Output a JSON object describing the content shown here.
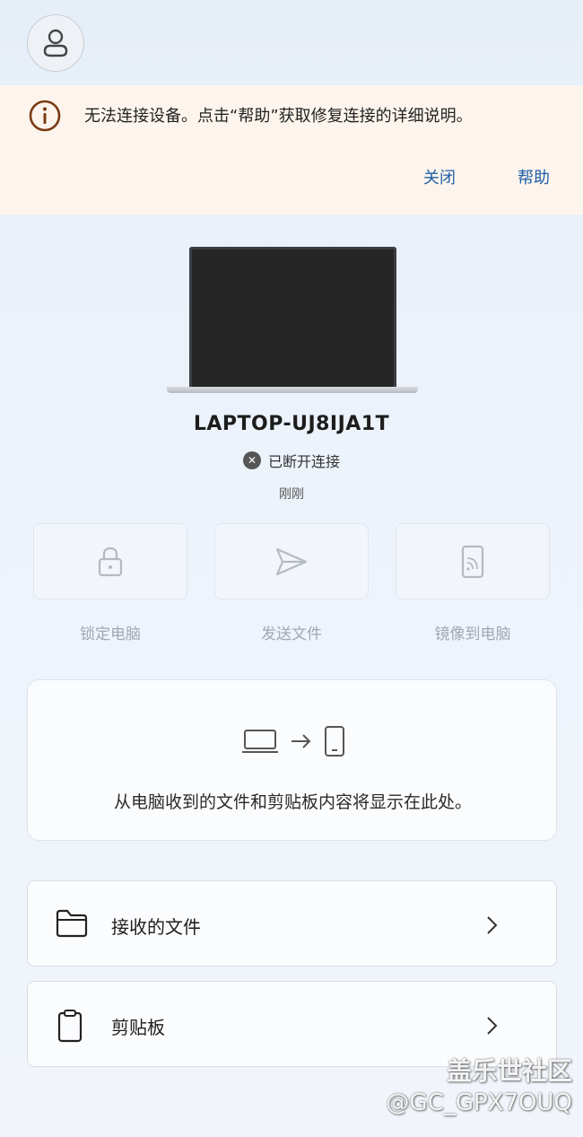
{
  "banner": {
    "message": "无法连接设备。点击“帮助”获取修复连接的详细说明。",
    "close_label": "关闭",
    "help_label": "帮助"
  },
  "device": {
    "name": "LAPTOP-UJ8IJA1T",
    "status": "已断开连接",
    "last_seen": "刚刚"
  },
  "actions": [
    {
      "label": "锁定电脑",
      "icon": "lock-icon"
    },
    {
      "label": "发送文件",
      "icon": "send-icon"
    },
    {
      "label": "镜像到电脑",
      "icon": "mirror-screen-icon"
    }
  ],
  "info_card": {
    "text": "从电脑收到的文件和剪贴板内容将显示在此处。"
  },
  "rows": [
    {
      "label": "接收的文件",
      "icon": "folder-icon"
    },
    {
      "label": "剪贴板",
      "icon": "clipboard-icon"
    }
  ],
  "watermark": {
    "line1": "盖乐世社区",
    "line2": "@GC_GPX7OUQ"
  },
  "colors": {
    "accent": "#1f5ea8",
    "banner_bg": "#fdf5ed",
    "warning_icon": "#7a3b12"
  }
}
